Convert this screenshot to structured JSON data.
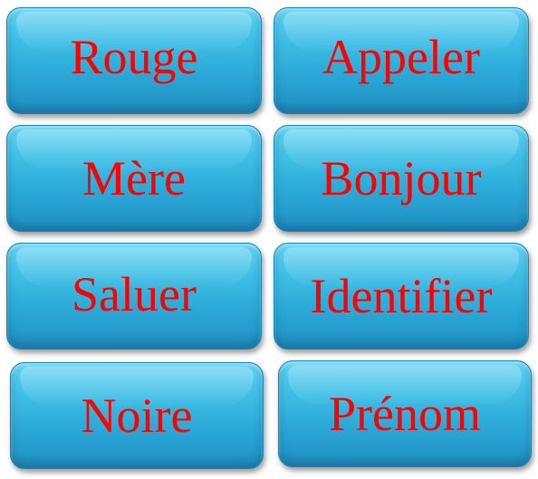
{
  "cards": [
    {
      "label": "Rouge"
    },
    {
      "label": "Appeler"
    },
    {
      "label": "Mère"
    },
    {
      "label": "Bonjour"
    },
    {
      "label": "Saluer"
    },
    {
      "label": "Identifier"
    },
    {
      "label": "Noire"
    },
    {
      "label": "Prénom"
    }
  ],
  "colors": {
    "card_blue": "#3fbfe6",
    "text_red": "#ff0000"
  }
}
